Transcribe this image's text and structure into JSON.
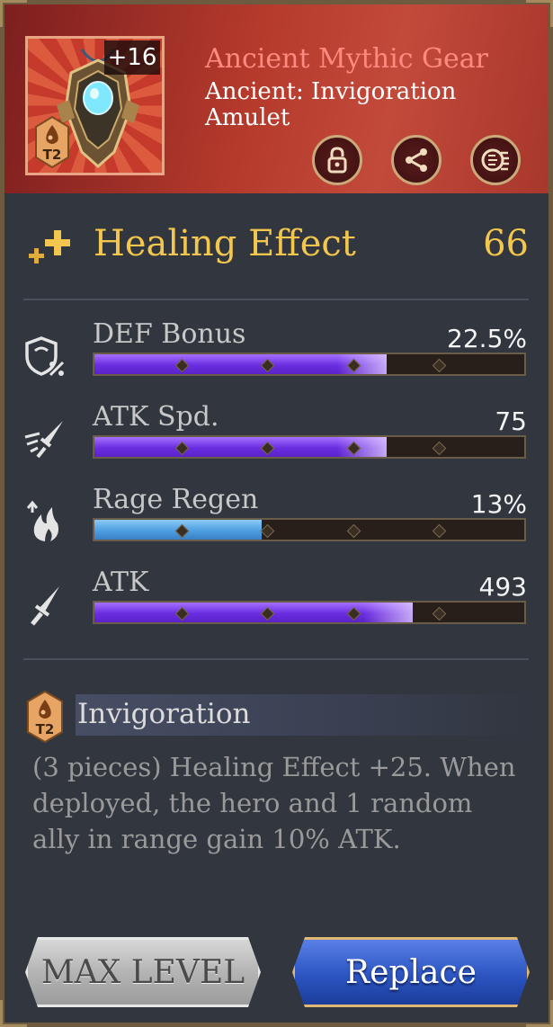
{
  "item": {
    "rarity": "Ancient Mythic Gear",
    "name": "Ancient: Invigoration Amulet",
    "level_badge": "+16",
    "tier": "T2",
    "icon": "amulet-icon"
  },
  "header_actions": [
    {
      "icon": "lock-icon"
    },
    {
      "icon": "share-icon"
    },
    {
      "icon": "disassemble-icon"
    }
  ],
  "main_stat": {
    "label": "Healing Effect",
    "value": "66",
    "icon": "healing-sparkle-icon"
  },
  "stats": [
    {
      "label": "DEF Bonus",
      "value": "22.5%",
      "icon": "shield-percent-icon",
      "fill": 0.68,
      "color": "purple"
    },
    {
      "label": "ATK Spd.",
      "value": "75",
      "icon": "sword-speed-icon",
      "fill": 0.68,
      "color": "purple"
    },
    {
      "label": "Rage Regen",
      "value": "13%",
      "icon": "rage-flame-icon",
      "fill": 0.39,
      "color": "blue"
    },
    {
      "label": "ATK",
      "value": "493",
      "icon": "sword-icon",
      "fill": 0.74,
      "color": "purple"
    }
  ],
  "set_bonus": {
    "tier": "T2",
    "title": "Invigoration",
    "description": "(3 pieces) Healing Effect +25. When deployed, the hero and 1 random ally in range gain 10% ATK."
  },
  "buttons": {
    "max_level": "MAX LEVEL",
    "replace": "Replace"
  },
  "colors": {
    "accent_gold": "#f3c74e",
    "rarity_red": "#ff8a80",
    "bar_purple": "#6a2ee0",
    "bar_blue": "#4e9fe2"
  }
}
